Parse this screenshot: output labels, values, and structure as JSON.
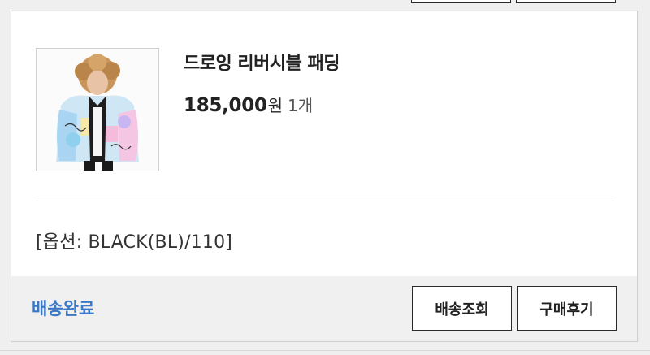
{
  "product": {
    "name": "드로잉 리버시블 패딩",
    "price": "185,000",
    "currency": "원",
    "quantity": "1개",
    "image_icon": "product-photo-icon"
  },
  "option": {
    "text": "[옵션: BLACK(BL)/110]"
  },
  "footer": {
    "status": "배송완료",
    "status_color": "#3a78c8",
    "track_label": "배송조회",
    "review_label": "구매후기"
  }
}
